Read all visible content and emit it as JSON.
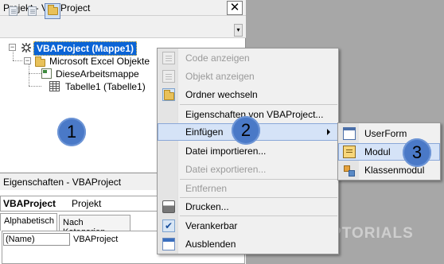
{
  "project_explorer": {
    "title": "Projekt - VBAProject",
    "close_glyph": "✕",
    "tree": {
      "root": "VBAProject (Mappe1)",
      "folder": "Microsoft Excel Objekte",
      "items": [
        "DieseArbeitsmappe",
        "Tabelle1 (Tabelle1)"
      ]
    }
  },
  "properties": {
    "title": "Eigenschaften - VBAProject",
    "selector_name": "VBAProject",
    "selector_type": "Projekt",
    "tabs": [
      "Alphabetisch",
      "Nach Kategorien"
    ],
    "rows": [
      {
        "name": "(Name)",
        "value": "VBAProject"
      }
    ]
  },
  "context_menu": {
    "items": [
      {
        "label": "Code anzeigen",
        "enabled": false,
        "icon": "code-icon"
      },
      {
        "label": "Objekt anzeigen",
        "enabled": false,
        "icon": "object-icon"
      },
      {
        "label": "Ordner wechseln",
        "enabled": true,
        "icon": "folder-icon"
      },
      {
        "label": "Eigenschaften von VBAProject...",
        "enabled": true
      },
      {
        "label": "Einfügen",
        "enabled": true,
        "submenu": true,
        "highlighted": true
      },
      {
        "label": "Datei importieren...",
        "enabled": true
      },
      {
        "label": "Datei exportieren...",
        "enabled": false
      },
      {
        "label": "Entfernen",
        "enabled": false
      },
      {
        "label": "Drucken...",
        "enabled": true,
        "icon": "printer-icon"
      },
      {
        "label": "Verankerbar",
        "enabled": true,
        "checked": true,
        "icon": "checkmark-icon"
      },
      {
        "label": "Ausblenden",
        "enabled": true,
        "icon": "hide-icon"
      }
    ]
  },
  "submenu": {
    "items": [
      {
        "label": "UserForm",
        "icon": "userform-icon"
      },
      {
        "label": "Modul",
        "icon": "module-icon",
        "highlighted": true
      },
      {
        "label": "Klassenmodul",
        "icon": "class-module-icon"
      }
    ]
  },
  "step_badges": [
    "1",
    "2",
    "3"
  ],
  "watermark": "TOPTORIALS",
  "colors": {
    "selection": "#0a64d6",
    "badge": "#4a79c7",
    "menu_highlight": "#d5e3f7"
  }
}
